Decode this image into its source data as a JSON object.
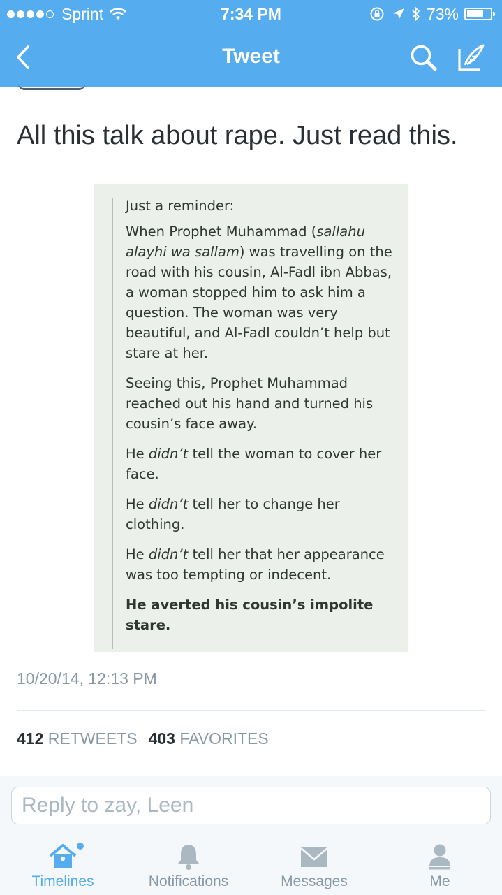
{
  "status_bar": {
    "carrier": "Sprint",
    "time": "7:34 PM",
    "battery": "73%",
    "battery_level": 0.73,
    "signal_bars_filled": 4,
    "signal_bars_total": 5
  },
  "nav": {
    "title": "Tweet",
    "back_icon": "chevron-left-icon",
    "search_icon": "search-icon",
    "compose_icon": "compose-icon"
  },
  "tweet": {
    "text": "All this talk about rape. Just read this.",
    "timestamp": "10/20/14, 12:13 PM",
    "retweets_count": "412",
    "retweets_label": "RETWEETS",
    "favorites_count": "403",
    "favorites_label": "FAVORITES"
  },
  "media": {
    "p1": "Just a reminder:",
    "p2_a": "When Prophet Muhammad (",
    "p2_em": "sallahu alayhi wa sallam",
    "p2_b": ") was travelling on the road with his cousin, Al-Fadl ibn Abbas, a woman stopped him to ask him a question. The woman was very beautiful, and Al-Fadl couldn’t help but stare at her.",
    "p3": "Seeing this, Prophet Muhammad reached out his hand and turned his cousin’s face away.",
    "p4_a": "He ",
    "p4_em": "didn’t",
    "p4_b": " tell the woman to cover her face.",
    "p5_a": "He ",
    "p5_em": "didn’t",
    "p5_b": " tell her to change her clothing.",
    "p6_a": "He ",
    "p6_em": "didn’t",
    "p6_b": " tell her that her appearance was too tempting or indecent.",
    "p7": "He averted his cousin’s impolite stare."
  },
  "reply": {
    "placeholder": "Reply to zay, Leen"
  },
  "tabs": [
    {
      "label": "Timelines",
      "icon": "home-icon",
      "active": true
    },
    {
      "label": "Notifications",
      "icon": "bell-icon",
      "active": false
    },
    {
      "label": "Messages",
      "icon": "envelope-icon",
      "active": false
    },
    {
      "label": "Me",
      "icon": "person-icon",
      "active": false
    }
  ],
  "colors": {
    "brand": "#55acee",
    "muted": "#8899a6",
    "text": "#292f33",
    "media_bg": "#ebf0ea"
  }
}
